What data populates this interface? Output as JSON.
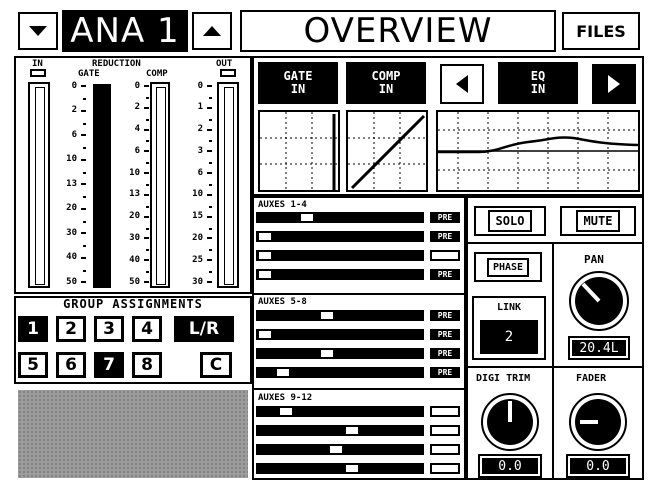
{
  "header": {
    "channel_down_icon": "triangle-down",
    "channel_name": "ANA 1",
    "channel_up_icon": "triangle-up",
    "title": "OVERVIEW",
    "files_label": "FILES"
  },
  "meters": {
    "in_label": "IN",
    "out_label": "OUT",
    "reduction_label": "REDUCTION",
    "gate_label": "GATE",
    "comp_label": "COMP",
    "io_scale": [
      "0",
      "2",
      "6",
      "10",
      "13",
      "20",
      "30",
      "40",
      "50"
    ],
    "gate_scale": [
      "0",
      "2",
      "4",
      "6",
      "10",
      "13",
      "20",
      "30",
      "40",
      "50"
    ],
    "comp_scale": [
      "0",
      "1",
      "2",
      "3",
      "6",
      "10",
      "15",
      "20",
      "25",
      "30"
    ]
  },
  "processing": {
    "gate_button": "GATE IN",
    "comp_button": "COMP IN",
    "eq_button": "EQ IN"
  },
  "groups": {
    "title": "GROUP ASSIGNMENTS",
    "row1": [
      {
        "label": "1",
        "active": true
      },
      {
        "label": "2",
        "active": false
      },
      {
        "label": "3",
        "active": false
      },
      {
        "label": "4",
        "active": false
      },
      {
        "label": "L/R",
        "active": true
      }
    ],
    "row2": [
      {
        "label": "5",
        "active": false
      },
      {
        "label": "6",
        "active": false
      },
      {
        "label": "7",
        "active": true
      },
      {
        "label": "8",
        "active": false
      },
      {
        "label": "C",
        "active": false
      }
    ]
  },
  "auxes": {
    "group1_title": "AUXES 1-4",
    "group2_title": "AUXES 5-8",
    "group3_title": "AUXES 9-12",
    "pre_label": "PRE",
    "rows1": [
      {
        "level": 0.28,
        "pre": true
      },
      {
        "level": 0.0,
        "pre": true
      },
      {
        "level": 0.0,
        "pre": false
      },
      {
        "level": 0.0,
        "pre": true
      }
    ],
    "rows2": [
      {
        "level": 0.41,
        "pre": true
      },
      {
        "level": 0.0,
        "pre": true
      },
      {
        "level": 0.41,
        "pre": true
      },
      {
        "level": 0.12,
        "pre": true
      }
    ],
    "rows3": [
      {
        "level": 0.14,
        "pre": false
      },
      {
        "level": 0.58,
        "pre": false
      },
      {
        "level": 0.47,
        "pre": false
      },
      {
        "level": 0.58,
        "pre": false
      }
    ]
  },
  "controls": {
    "solo_label": "SOLO",
    "mute_label": "MUTE",
    "phase_label": "PHASE",
    "pan_label": "PAN",
    "pan_value": "20.4L",
    "link_label": "LINK",
    "link_value": "2",
    "digi_trim_label": "DIGI TRIM",
    "digi_trim_value": "0.0",
    "fader_label": "FADER",
    "fader_value": "0.0"
  }
}
